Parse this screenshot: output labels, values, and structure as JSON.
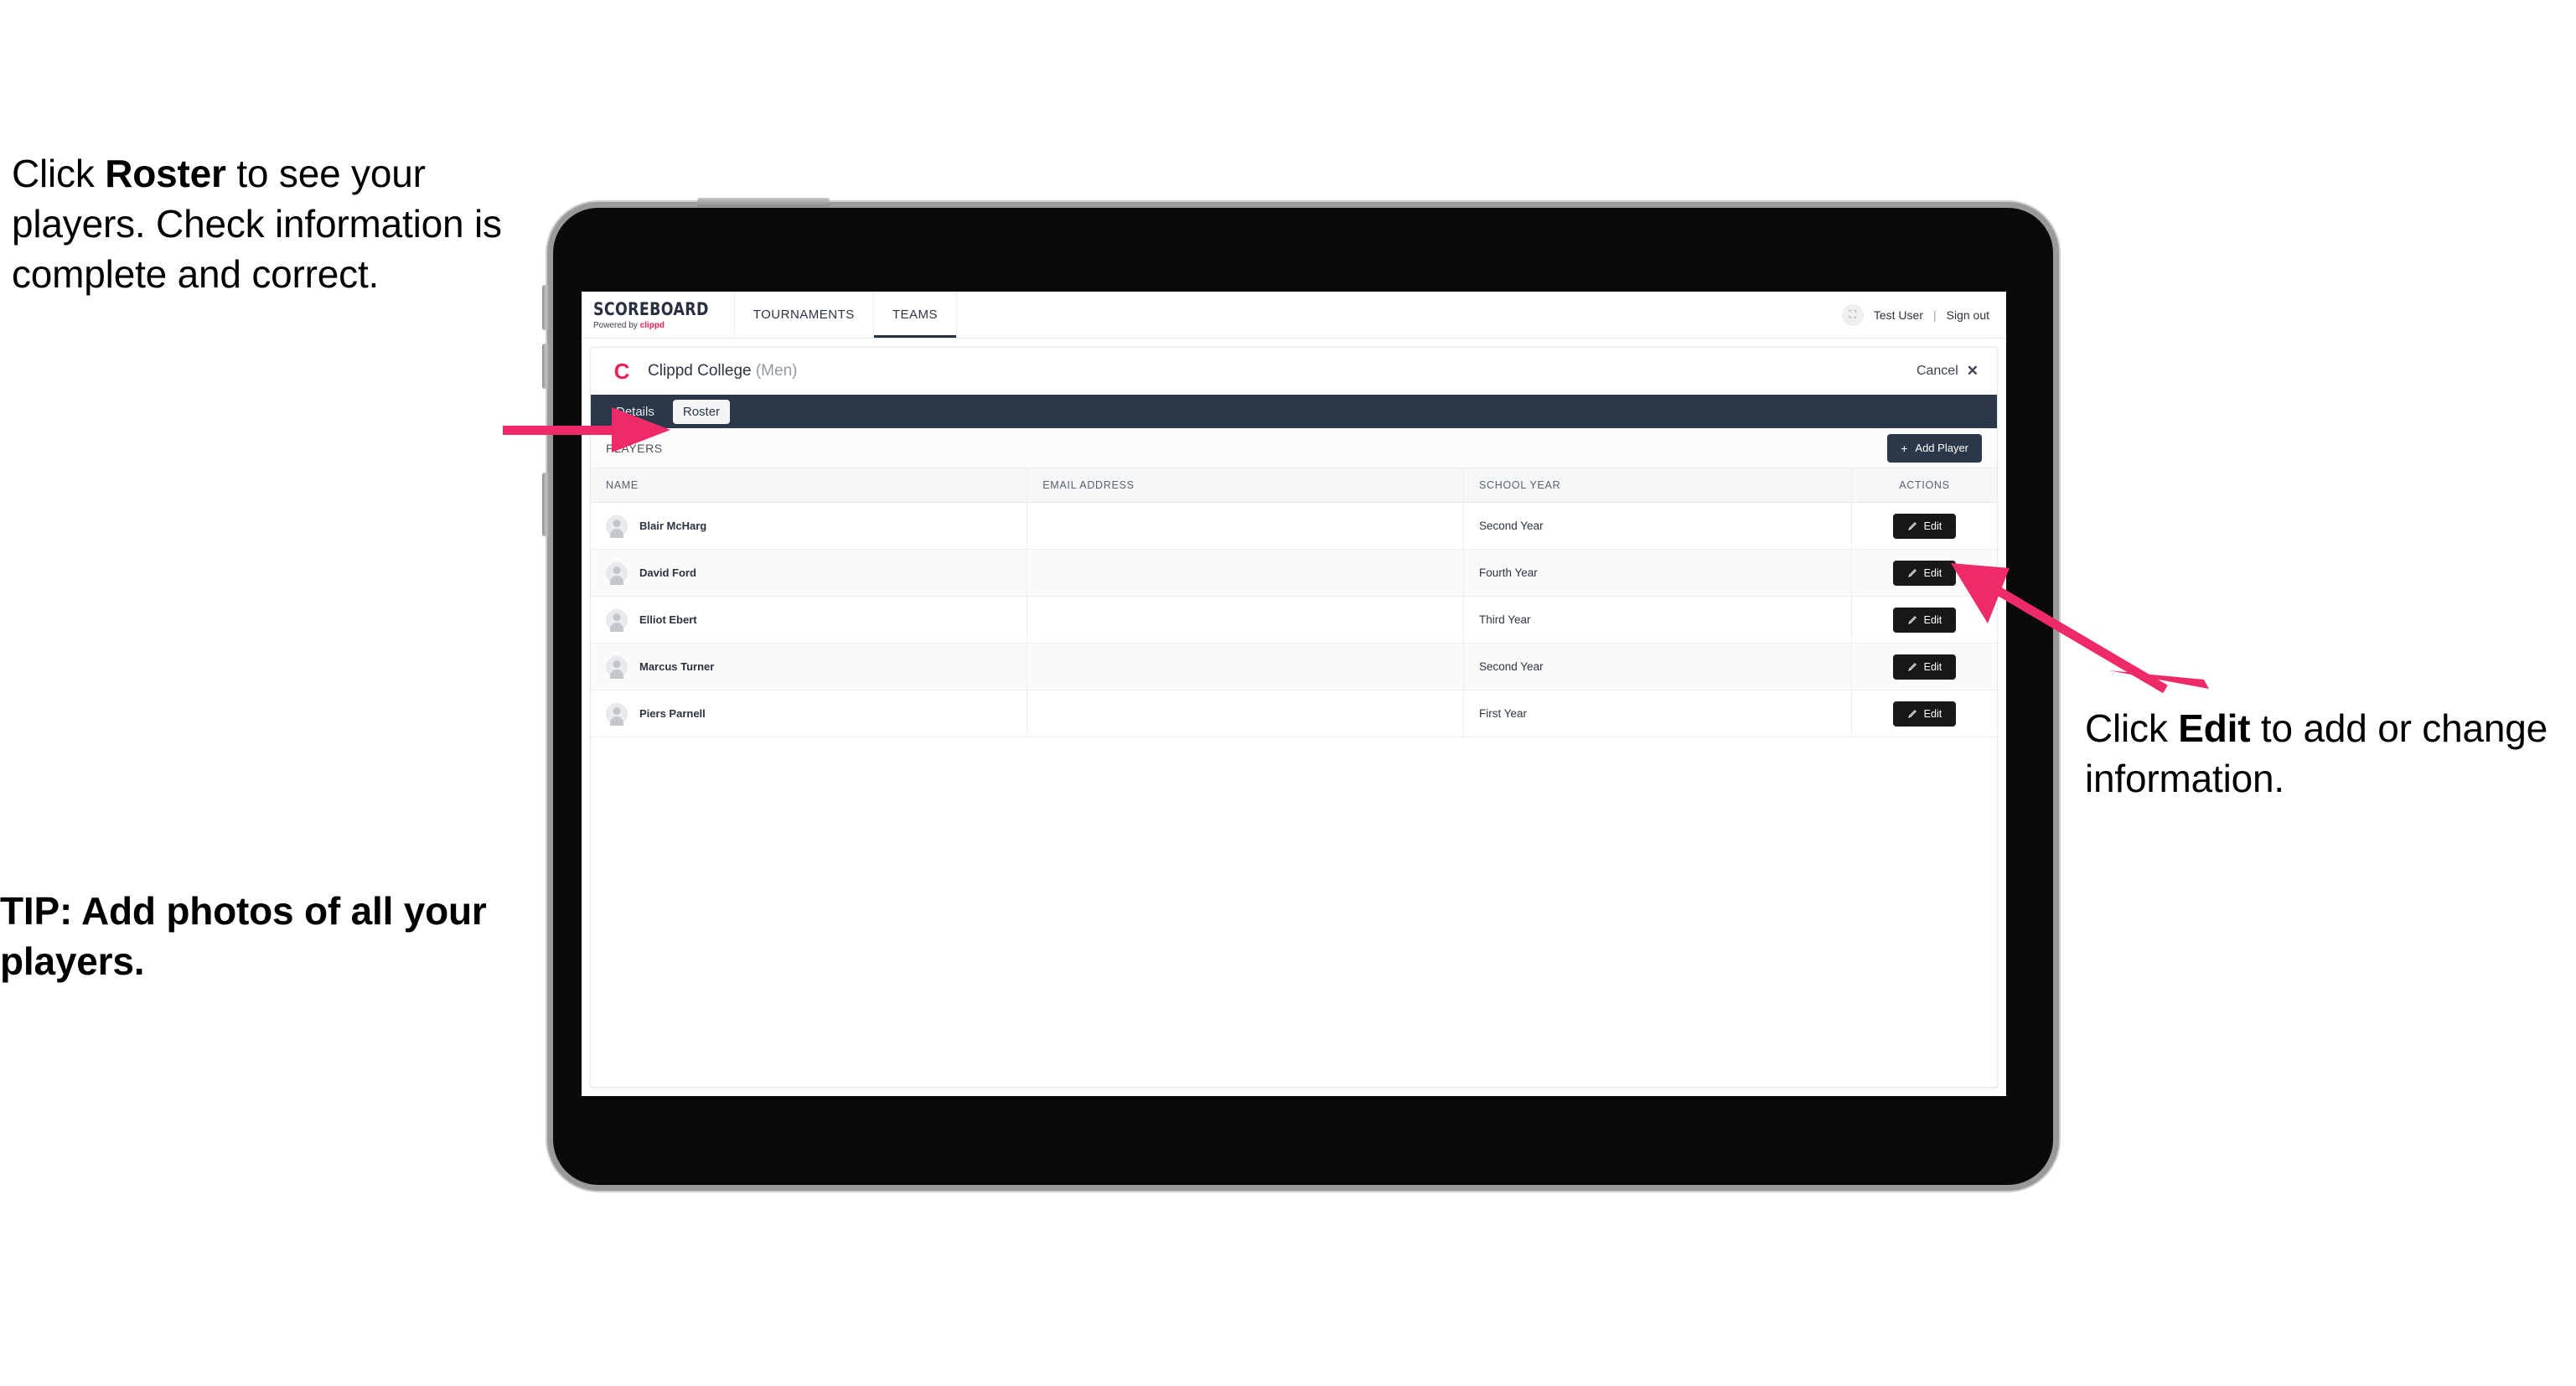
{
  "annotations": {
    "left": {
      "pre": "Click ",
      "bold": "Roster",
      "post": " to see your players. Check information is complete and correct."
    },
    "tip": "TIP: Add photos of all your players.",
    "right": {
      "pre": "Click ",
      "bold": "Edit",
      "post": " to add or change information."
    }
  },
  "colors": {
    "arrow_pink": "#ef2a68",
    "brand_pink": "#ec1f52",
    "navy": "#2b3849",
    "dark_button": "#17181a"
  },
  "app": {
    "brand": {
      "name": "SCOREBOARD",
      "powered_by": "Powered by ",
      "powered_by_brand": "clippd"
    },
    "nav_tabs": [
      {
        "label": "TOURNAMENTS",
        "active": false
      },
      {
        "label": "TEAMS",
        "active": true
      }
    ],
    "user": {
      "name": "Test User",
      "separator": "|",
      "sign_out": "Sign out",
      "avatar_glyph": "⛶"
    },
    "panel": {
      "team_logo_letter": "C",
      "team_name": "Clippd College",
      "team_gender": "(Men)",
      "cancel_label": "Cancel",
      "cancel_icon": "✕",
      "subtabs": [
        {
          "label": "Details",
          "active": false
        },
        {
          "label": "Roster",
          "active": true
        }
      ],
      "players_section_label": "PLAYERS",
      "add_player_label": "Add Player",
      "add_player_plus": "+",
      "table": {
        "columns": [
          "NAME",
          "EMAIL ADDRESS",
          "SCHOOL YEAR",
          "ACTIONS"
        ],
        "rows": [
          {
            "name": "Blair McHarg",
            "email": "",
            "school_year": "Second Year",
            "action": "Edit"
          },
          {
            "name": "David Ford",
            "email": "",
            "school_year": "Fourth Year",
            "action": "Edit"
          },
          {
            "name": "Elliot Ebert",
            "email": "",
            "school_year": "Third Year",
            "action": "Edit"
          },
          {
            "name": "Marcus Turner",
            "email": "",
            "school_year": "Second Year",
            "action": "Edit"
          },
          {
            "name": "Piers Parnell",
            "email": "",
            "school_year": "First Year",
            "action": "Edit"
          }
        ]
      }
    }
  }
}
